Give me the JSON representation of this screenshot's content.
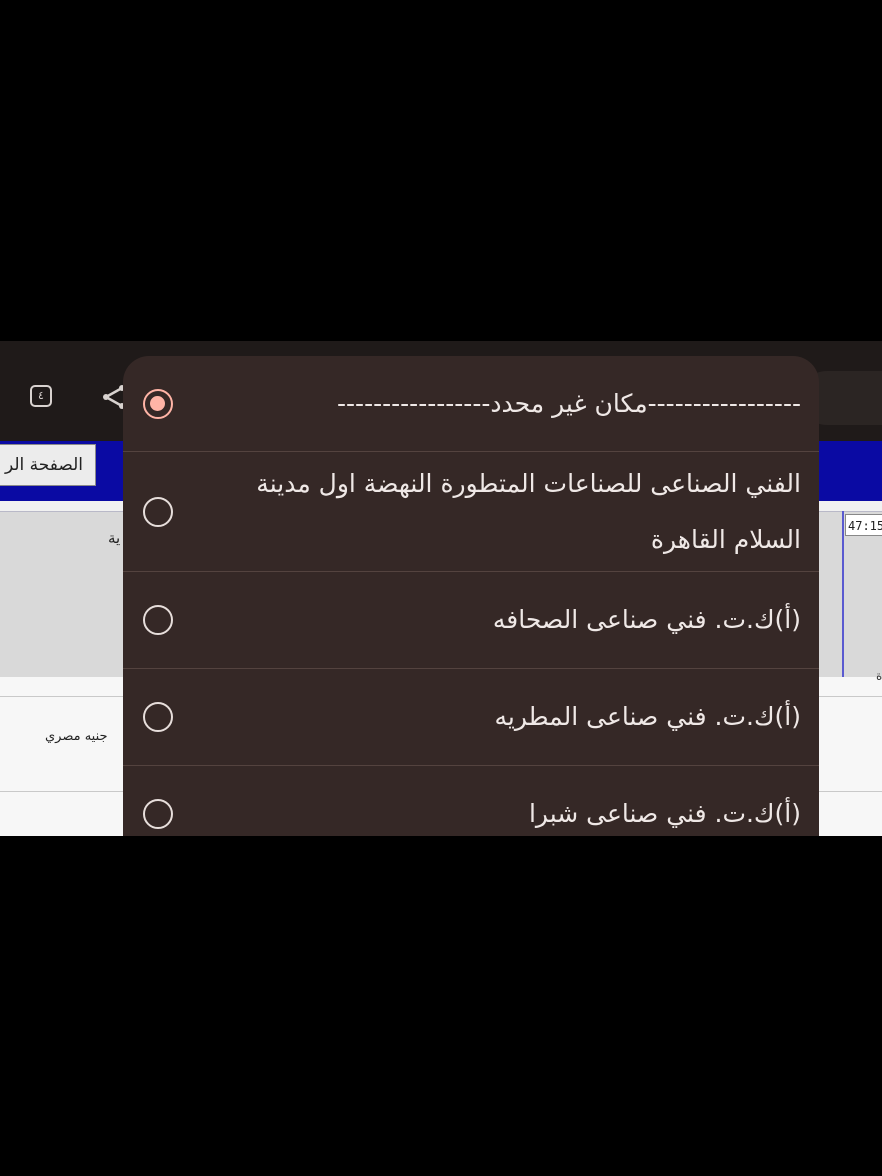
{
  "toolbar": {
    "tab_count": "٤",
    "share_icon": "share-icon"
  },
  "page": {
    "home_button": "الصفحة الر",
    "panel_label": "ية",
    "clock": "47:15",
    "currency": "جنيه مصري",
    "side_mark": "ة"
  },
  "dropdown": {
    "selected_index": 0,
    "options": [
      {
        "label": "-----------------مكان غير محدد-----------------",
        "selected": true
      },
      {
        "label": "الفني الصناعى للصناعات المتطورة النهضة اول مدينة السلام القاهرة",
        "selected": false
      },
      {
        "label": "(أ)ك.ت. فني صناعى الصحافه",
        "selected": false
      },
      {
        "label": "(أ)ك.ت. فني صناعى المطريه",
        "selected": false
      },
      {
        "label": "(أ)ك.ت. فني صناعى شبرا",
        "selected": false
      }
    ],
    "accent_color": "#ffb4a6",
    "sheet_color": "#352826"
  }
}
